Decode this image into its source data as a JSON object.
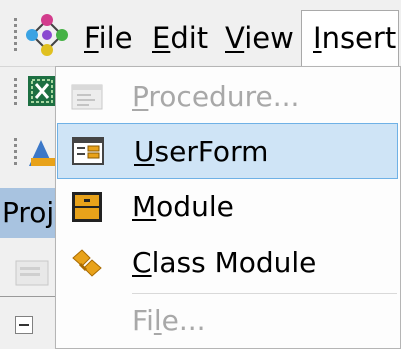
{
  "menubar": {
    "items": [
      {
        "label": "File",
        "u": "F",
        "rest": "ile"
      },
      {
        "label": "Edit",
        "u": "E",
        "rest": "dit"
      },
      {
        "label": "View",
        "u": "V",
        "rest": "iew"
      },
      {
        "label": "Insert",
        "u": "I",
        "rest": "nsert"
      }
    ]
  },
  "side": {
    "project_label": "Proj"
  },
  "dropdown": {
    "items": [
      {
        "label": "Procedure...",
        "u": "P",
        "rest": "rocedure...",
        "enabled": false,
        "icon": "procedure-icon"
      },
      {
        "label": "UserForm",
        "u": "U",
        "rest": "serForm",
        "enabled": true,
        "icon": "userform-icon",
        "highlighted": true
      },
      {
        "label": "Module",
        "u": "M",
        "rest": "odule",
        "enabled": true,
        "icon": "module-icon"
      },
      {
        "label": "Class Module",
        "u": "C",
        "rest": "lass Module",
        "enabled": true,
        "icon": "class-module-icon"
      },
      {
        "label": "File...",
        "pre": "Fi",
        "u": "l",
        "rest": "e...",
        "enabled": false
      }
    ]
  },
  "colors": {
    "highlight_bg": "#cfe4f6",
    "highlight_border": "#6fb1e6",
    "disabled_text": "#a8a8a8",
    "project_panel": "#a8c3e0"
  }
}
